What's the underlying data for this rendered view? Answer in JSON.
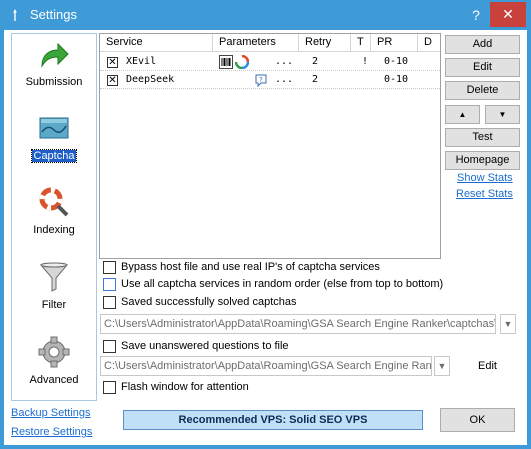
{
  "window": {
    "title": "Settings",
    "help_label": "?",
    "close_label": "✕"
  },
  "sidebar": {
    "items": [
      {
        "label": "Submission",
        "icon": "green-arrow-icon"
      },
      {
        "label": "Captcha",
        "icon": "captcha-image-icon",
        "selected": true
      },
      {
        "label": "Indexing",
        "icon": "magnifier-lifebuoy-icon"
      },
      {
        "label": "Filter",
        "icon": "funnel-icon"
      },
      {
        "label": "Advanced",
        "icon": "gear-icon"
      }
    ],
    "backup_label": "Backup Settings",
    "restore_label": "Restore Settings"
  },
  "grid": {
    "columns": [
      "Service",
      "Parameters",
      "Retry",
      "T",
      "PR",
      "D"
    ],
    "rows": [
      {
        "checked": true,
        "service": "XEvil",
        "params": "...",
        "retry": "2",
        "t": "!",
        "pr": "0-10",
        "d": ""
      },
      {
        "checked": true,
        "service": "DeepSeek",
        "params": "...",
        "retry": "2",
        "t": "",
        "pr": "0-10",
        "d": ""
      }
    ]
  },
  "buttons": {
    "add": "Add",
    "edit": "Edit",
    "delete": "Delete",
    "up": "▲",
    "down": "▼",
    "test": "Test",
    "homepage": "Homepage",
    "show_stats": "Show Stats",
    "reset_stats": "Reset Stats",
    "edit2": "Edit",
    "ok": "OK"
  },
  "options": {
    "bypass_hosts": "Bypass host file and use real IP's of captcha services",
    "random_order": "Use all captcha services in random order (else from top to bottom)",
    "save_solved": "Saved successfully solved captchas",
    "save_solved_path": "C:\\Users\\Administrator\\AppData\\Roaming\\GSA Search Engine Ranker\\captchas\\%",
    "save_unanswered": "Save unanswered questions to file",
    "save_unanswered_path": "C:\\Users\\Administrator\\AppData\\Roaming\\GSA Search Engine Ranke",
    "flash_window": "Flash window for attention"
  },
  "promo": {
    "label": "Recommended VPS: Solid SEO VPS"
  },
  "colors": {
    "titlebar": "#3e9bd8",
    "close": "#c8413b",
    "selection": "#1e5fc7",
    "link": "#1c6dd0"
  }
}
